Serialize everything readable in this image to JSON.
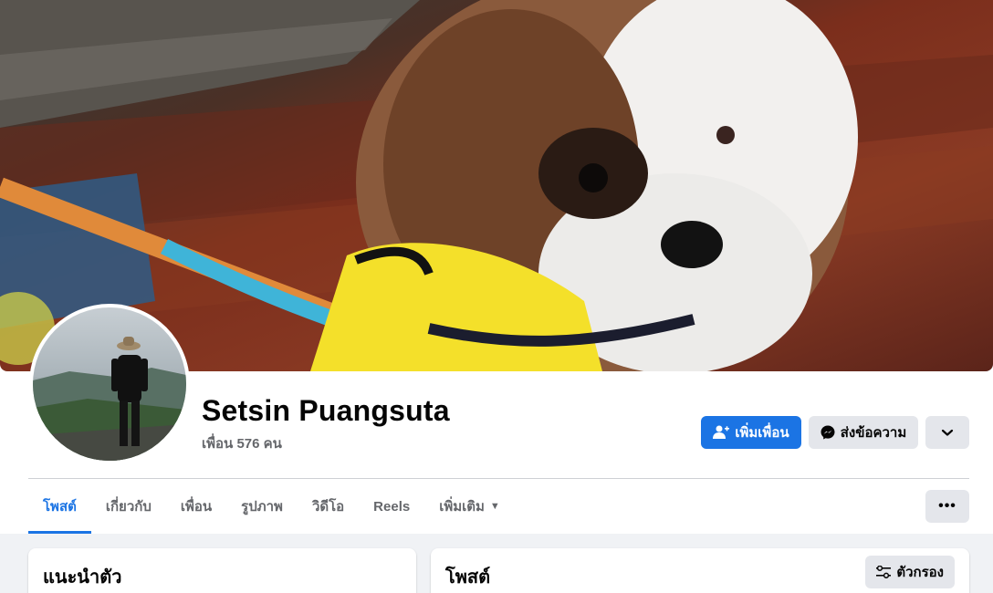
{
  "profile": {
    "name": "Setsin Puangsuta",
    "friends_text": "เพื่อน 576 คน"
  },
  "actions": {
    "add_friend": "เพิ่มเพื่อน",
    "message": "ส่งข้อความ"
  },
  "tabs": [
    {
      "label": "โพสต์",
      "active": true
    },
    {
      "label": "เกี่ยวกับ"
    },
    {
      "label": "เพื่อน"
    },
    {
      "label": "รูปภาพ"
    },
    {
      "label": "วิดีโอ"
    },
    {
      "label": "Reels"
    },
    {
      "label": "เพิ่มเติม"
    }
  ],
  "intro": {
    "title": "แนะนำตัว"
  },
  "posts": {
    "title": "โพสต์",
    "filter_label": "ตัวกรอง"
  },
  "colors": {
    "accent": "#1b74e4",
    "secondary_bg": "#e4e6eb",
    "page_bg": "#f0f2f5"
  }
}
